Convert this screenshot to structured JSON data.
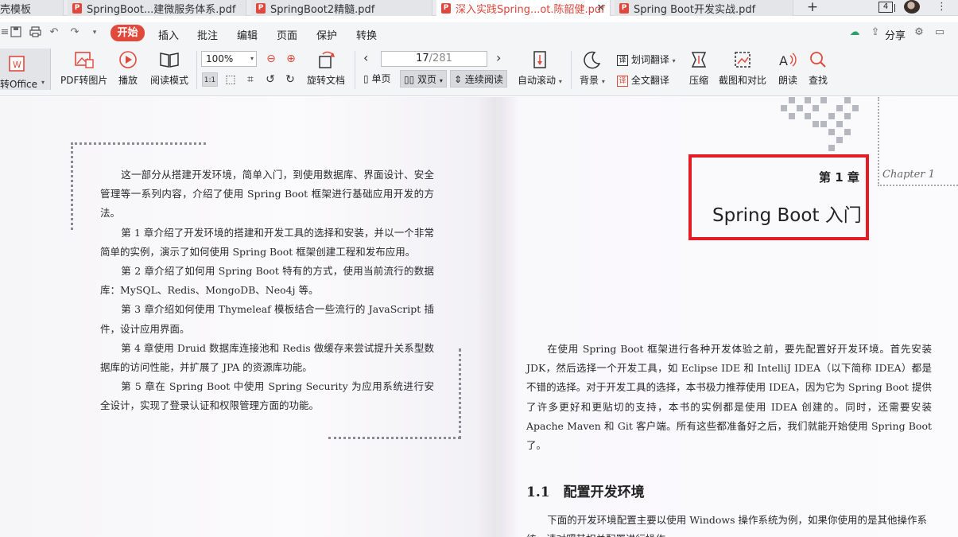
{
  "tabs": [
    {
      "label": "壳模板",
      "active": false
    },
    {
      "label": "SpringBoot...建微服务体系.pdf",
      "active": false
    },
    {
      "label": "SpringBoot2精髓.pdf",
      "active": false
    },
    {
      "label": "深入实践Spring...ot.陈韶健.pdf",
      "active": true
    },
    {
      "label": "Spring Boot开发实战.pdf",
      "active": false
    }
  ],
  "tab_count": "4",
  "menu": {
    "start": "开始",
    "items": [
      "插入",
      "批注",
      "编辑",
      "页面",
      "保护",
      "转换"
    ],
    "share": "分享"
  },
  "toolbar": {
    "to_office": "转Office",
    "pdf_to_image": "PDF转图片",
    "play": "播放",
    "read_mode": "阅读模式",
    "zoom": "100%",
    "rotate": "旋转文档",
    "page_current": "17",
    "page_total": "/281",
    "single_page": "单页",
    "double_page": "双页",
    "continuous": "连续阅读",
    "auto_scroll": "自动滚动",
    "background": "背景",
    "word_translate": "划词翻译",
    "full_translate": "全文翻译",
    "compress": "压缩",
    "screenshot_compare": "截图和对比",
    "read_aloud": "朗读",
    "find": "查找"
  },
  "left_page": {
    "paragraphs": [
      "这一部分从搭建开发环境，简单入门，到使用数据库、界面设计、安全管理等一系列内容，介绍了使用 Spring Boot 框架进行基础应用开发的方法。",
      "第 1 章介绍了开发环境的搭建和开发工具的选择和安装，并以一个非常简单的实例，演示了如何使用 Spring Boot 框架创建工程和发布应用。",
      "第 2 章介绍了如何用 Spring Boot 特有的方式，使用当前流行的数据库：MySQL、Redis、MongoDB、Neo4j 等。",
      "第 3 章介绍如何使用 Thymeleaf 模板结合一些流行的 JavaScript 插件，设计应用界面。",
      "第 4 章使用 Druid 数据库连接池和 Redis 做缓存来尝试提升关系型数据库的访问性能，并扩展了 JPA 的资源库功能。",
      "第 5 章在 Spring Boot 中使用 Spring Security 为应用系统进行安全设计，实现了登录认证和权限管理方面的功能。"
    ]
  },
  "right_page": {
    "chapter_number": "第 1 章",
    "chapter_title": "Spring Boot 入门",
    "chapter_script": "Chapter 1",
    "intro": "在使用 Spring Boot 框架进行各种开发体验之前，要先配置好开发环境。首先安装 JDK，然后选择一个开发工具，如 Eclipse IDE 和 IntelliJ IDEA（以下简称 IDEA）都是不错的选择。对于开发工具的选择，本书极力推荐使用 IDEA，因为它为 Spring Boot 提供了许多更好和更贴切的支持，本书的实例都是使用 IDEA 创建的。同时，还需要安装 Apache Maven 和 Git 客户端。所有这些都准备好之后，我们就能开始使用 Spring Boot 了。",
    "section_heading": "1.1　配置开发环境",
    "section_body": "下面的开发环境配置主要以使用 Windows 操作系统为例，如果你使用的是其他操作系统，请对照其相关配置进行操作。"
  },
  "colors": {
    "accent": "#e04a3d",
    "highlight_box": "#e51c24"
  }
}
